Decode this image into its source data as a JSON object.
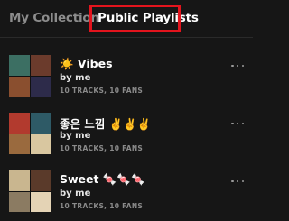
{
  "tabs": [
    {
      "label": "My Collection",
      "active": false
    },
    {
      "label": "Public Playlists",
      "active": true
    }
  ],
  "colors": {
    "background": "#161616",
    "highlight": "#e3141d",
    "inactive_tab": "#8c8c8c",
    "meta_text": "#8a8a8a"
  },
  "playlists": [
    {
      "title": "☀️ Vibes",
      "owner": "by me",
      "meta": "10 TRACKS, 10 FANS",
      "cover_colors": [
        "#3c6f63",
        "#6b3b2c",
        "#8a4f2f",
        "#2d2b4a"
      ]
    },
    {
      "title": "좋은 느낌 ✌️✌️✌️",
      "owner": "by me",
      "meta": "10 TRACKS, 10 FANS",
      "cover_colors": [
        "#b23a2e",
        "#2e5a66",
        "#9a6a3e",
        "#d9c7a0"
      ]
    },
    {
      "title": "Sweet 🍬🍬🍬",
      "owner": "by me",
      "meta": "10 TRACKS, 10 FANS",
      "cover_colors": [
        "#c9b68f",
        "#5a3a2a",
        "#8b7b62",
        "#e4d3b5"
      ]
    }
  ],
  "icons": {
    "more": "more-options-icon"
  }
}
